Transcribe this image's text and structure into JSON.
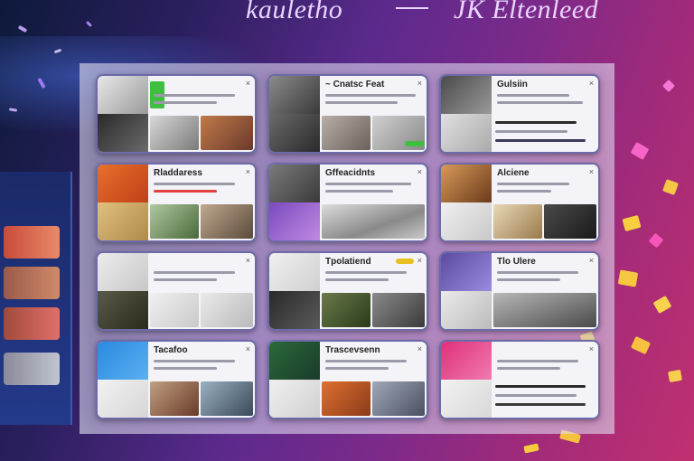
{
  "header": {
    "left_text": "kaulethо",
    "right_text": "JK Eltenleed"
  },
  "cards": [
    {
      "title": "",
      "accent": "#3fbf3f"
    },
    {
      "title": "~ Cnatsc Feat",
      "accent": "#777777"
    },
    {
      "title": "Gulsiin",
      "accent": "#555555"
    },
    {
      "title": "Rladdaress",
      "accent": "#e8702a"
    },
    {
      "title": "Gffeacidnts",
      "accent": "#7a4ac0"
    },
    {
      "title": "Alciene",
      "accent": "#d89a5a"
    },
    {
      "title": "",
      "accent": "#dddddd"
    },
    {
      "title": "Tpolatiend",
      "accent": "#e6c020"
    },
    {
      "title": "Tlo Ulere",
      "accent": "#5a4aa0"
    },
    {
      "title": "Tacafoo",
      "accent": "#2a8ae0"
    },
    {
      "title": "Trascevsenn",
      "accent": "#2a6a3a"
    },
    {
      "title": "",
      "accent": "#e0307a"
    }
  ]
}
